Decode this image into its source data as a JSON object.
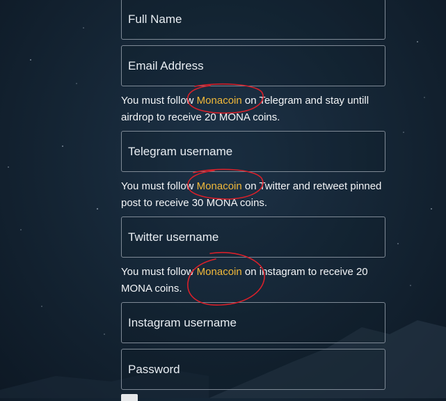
{
  "fields": {
    "full_name": {
      "placeholder": "Full Name",
      "value": ""
    },
    "email": {
      "placeholder": "Email Address",
      "value": ""
    },
    "telegram": {
      "placeholder": "Telegram username",
      "value": ""
    },
    "twitter": {
      "placeholder": "Twitter username",
      "value": ""
    },
    "instagram": {
      "placeholder": "Instagram username",
      "value": ""
    },
    "password": {
      "placeholder": "Password",
      "value": ""
    }
  },
  "notes": {
    "telegram": {
      "before": "You must follow ",
      "highlight": "Monacoin",
      "after": " on Telegram and stay untill airdrop to receive 20 MONA coins."
    },
    "twitter": {
      "before": "You must follow ",
      "highlight": "Monacoin",
      "after": " on Twitter and retweet pinned post to receive 30 MONA coins."
    },
    "instagram": {
      "before": "You must follow ",
      "highlight": "Monacoin",
      "after": " on instagram to receive 20 MONA coins."
    }
  },
  "colors": {
    "highlight": "#f0b83a",
    "annotation_circle": "#d8202a",
    "field_border": "#7f8a96"
  }
}
